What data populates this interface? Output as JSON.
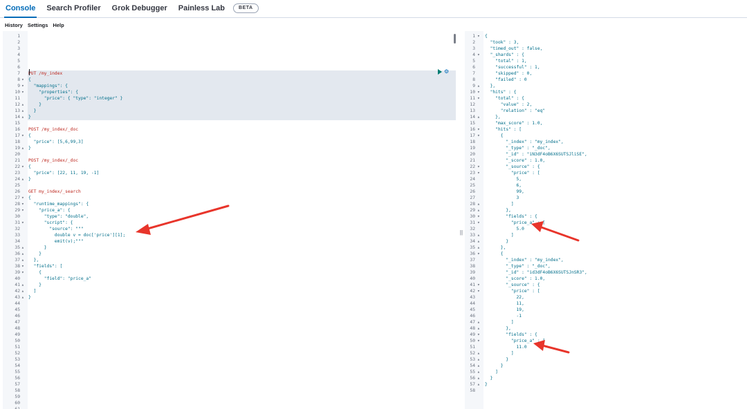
{
  "tabs": [
    {
      "label": "Console",
      "active": true
    },
    {
      "label": "Search Profiler",
      "active": false
    },
    {
      "label": "Grok Debugger",
      "active": false
    },
    {
      "label": "Painless Lab",
      "active": false
    }
  ],
  "beta_badge": "BETA",
  "toolbar": [
    "History",
    "Settings",
    "Help"
  ],
  "divider_glyph": "||",
  "request_lines": [
    {
      "n": "1",
      "f": "",
      "c": ""
    },
    {
      "n": "2",
      "f": "",
      "c": ""
    },
    {
      "n": "3",
      "f": "",
      "c": ""
    },
    {
      "n": "4",
      "f": "",
      "c": ""
    },
    {
      "n": "5",
      "f": "",
      "c": ""
    },
    {
      "n": "6",
      "f": "",
      "c": ""
    },
    {
      "n": "7",
      "f": "",
      "c": "PUT /my_index",
      "method": true,
      "hl": true
    },
    {
      "n": "8",
      "f": "▾",
      "c": "{",
      "hl": true
    },
    {
      "n": "9",
      "f": "▾",
      "c": "  \"mappings\": {",
      "hl": true
    },
    {
      "n": "10",
      "f": "▾",
      "c": "    \"properties\": {",
      "hl": true
    },
    {
      "n": "11",
      "f": "",
      "c": "      \"price\": { \"type\": \"integer\" }",
      "hl": true
    },
    {
      "n": "12",
      "f": "▴",
      "c": "    }",
      "hl": true
    },
    {
      "n": "13",
      "f": "▴",
      "c": "  }",
      "hl": true
    },
    {
      "n": "14",
      "f": "▴",
      "c": "}",
      "hl": true
    },
    {
      "n": "15",
      "f": "",
      "c": ""
    },
    {
      "n": "16",
      "f": "",
      "c": "POST /my_index/_doc",
      "method": true
    },
    {
      "n": "17",
      "f": "▾",
      "c": "{"
    },
    {
      "n": "18",
      "f": "",
      "c": "  \"price\": [5,6,99,3]"
    },
    {
      "n": "19",
      "f": "▴",
      "c": "}"
    },
    {
      "n": "20",
      "f": "",
      "c": ""
    },
    {
      "n": "21",
      "f": "",
      "c": "POST /my_index/_doc",
      "method": true
    },
    {
      "n": "22",
      "f": "▾",
      "c": "{"
    },
    {
      "n": "23",
      "f": "",
      "c": "  \"price\": [22, 11, 19, -1]"
    },
    {
      "n": "24",
      "f": "▴",
      "c": "}"
    },
    {
      "n": "25",
      "f": "",
      "c": ""
    },
    {
      "n": "26",
      "f": "",
      "c": "GET my_index/_search",
      "method": true
    },
    {
      "n": "27",
      "f": "▾",
      "c": "{"
    },
    {
      "n": "28",
      "f": "▾",
      "c": "  \"runtime_mappings\": {"
    },
    {
      "n": "29",
      "f": "▾",
      "c": "    \"price_a\": {"
    },
    {
      "n": "30",
      "f": "",
      "c": "      \"type\": \"double\","
    },
    {
      "n": "31",
      "f": "▾",
      "c": "      \"script\": {"
    },
    {
      "n": "32",
      "f": "",
      "c": "        \"source\": \"\"\""
    },
    {
      "n": "33",
      "f": "",
      "c": "          double v = doc['price'][1];"
    },
    {
      "n": "34",
      "f": "",
      "c": "          emit(v);\"\"\""
    },
    {
      "n": "35",
      "f": "▴",
      "c": "      }"
    },
    {
      "n": "36",
      "f": "▴",
      "c": "    }"
    },
    {
      "n": "37",
      "f": "▴",
      "c": "  },"
    },
    {
      "n": "38",
      "f": "▾",
      "c": "  \"fields\": ["
    },
    {
      "n": "39",
      "f": "▾",
      "c": "    {"
    },
    {
      "n": "40",
      "f": "",
      "c": "      \"field\": \"price_a\""
    },
    {
      "n": "41",
      "f": "▴",
      "c": "    }"
    },
    {
      "n": "42",
      "f": "▴",
      "c": "  ]"
    },
    {
      "n": "43",
      "f": "▴",
      "c": "}"
    },
    {
      "n": "44",
      "f": "",
      "c": ""
    },
    {
      "n": "45",
      "f": "",
      "c": ""
    },
    {
      "n": "46",
      "f": "",
      "c": ""
    },
    {
      "n": "47",
      "f": "",
      "c": ""
    },
    {
      "n": "48",
      "f": "",
      "c": ""
    },
    {
      "n": "49",
      "f": "",
      "c": ""
    },
    {
      "n": "50",
      "f": "",
      "c": ""
    },
    {
      "n": "51",
      "f": "",
      "c": ""
    },
    {
      "n": "52",
      "f": "",
      "c": ""
    },
    {
      "n": "53",
      "f": "",
      "c": ""
    },
    {
      "n": "54",
      "f": "",
      "c": ""
    },
    {
      "n": "55",
      "f": "",
      "c": ""
    },
    {
      "n": "56",
      "f": "",
      "c": ""
    },
    {
      "n": "57",
      "f": "",
      "c": ""
    },
    {
      "n": "58",
      "f": "",
      "c": ""
    },
    {
      "n": "59",
      "f": "",
      "c": ""
    },
    {
      "n": "60",
      "f": "",
      "c": ""
    },
    {
      "n": "61",
      "f": "",
      "c": ""
    }
  ],
  "response_lines": [
    {
      "n": "1",
      "f": "▾",
      "c": "{"
    },
    {
      "n": "2",
      "f": "",
      "c": "  \"took\" : 3,"
    },
    {
      "n": "3",
      "f": "",
      "c": "  \"timed_out\" : false,"
    },
    {
      "n": "4",
      "f": "▾",
      "c": "  \"_shards\" : {"
    },
    {
      "n": "5",
      "f": "",
      "c": "    \"total\" : 1,"
    },
    {
      "n": "6",
      "f": "",
      "c": "    \"successful\" : 1,"
    },
    {
      "n": "7",
      "f": "",
      "c": "    \"skipped\" : 0,"
    },
    {
      "n": "8",
      "f": "",
      "c": "    \"failed\" : 0"
    },
    {
      "n": "9",
      "f": "▴",
      "c": "  },"
    },
    {
      "n": "10",
      "f": "▾",
      "c": "  \"hits\" : {"
    },
    {
      "n": "11",
      "f": "▾",
      "c": "    \"total\" : {"
    },
    {
      "n": "12",
      "f": "",
      "c": "      \"value\" : 2,"
    },
    {
      "n": "13",
      "f": "",
      "c": "      \"relation\" : \"eq\""
    },
    {
      "n": "14",
      "f": "▴",
      "c": "    },"
    },
    {
      "n": "15",
      "f": "",
      "c": "    \"max_score\" : 1.0,"
    },
    {
      "n": "16",
      "f": "▾",
      "c": "    \"hits\" : ["
    },
    {
      "n": "17",
      "f": "▾",
      "c": "      {"
    },
    {
      "n": "18",
      "f": "",
      "c": "        \"_index\" : \"my_index\","
    },
    {
      "n": "19",
      "f": "",
      "c": "        \"_type\" : \"_doc\","
    },
    {
      "n": "20",
      "f": "",
      "c": "        \"_id\" : \"iN3dF4oB6X6SUTSJliSE\","
    },
    {
      "n": "21",
      "f": "",
      "c": "        \"_score\" : 1.0,"
    },
    {
      "n": "22",
      "f": "▾",
      "c": "        \"_source\" : {"
    },
    {
      "n": "23",
      "f": "▾",
      "c": "          \"price\" : ["
    },
    {
      "n": "24",
      "f": "",
      "c": "            5,"
    },
    {
      "n": "25",
      "f": "",
      "c": "            6,"
    },
    {
      "n": "26",
      "f": "",
      "c": "            99,"
    },
    {
      "n": "27",
      "f": "",
      "c": "            3"
    },
    {
      "n": "28",
      "f": "▴",
      "c": "          ]"
    },
    {
      "n": "29",
      "f": "▴",
      "c": "        },"
    },
    {
      "n": "30",
      "f": "▾",
      "c": "        \"fields\" : {"
    },
    {
      "n": "31",
      "f": "▾",
      "c": "          \"price_a\" : ["
    },
    {
      "n": "32",
      "f": "",
      "c": "            5.0"
    },
    {
      "n": "33",
      "f": "▴",
      "c": "          ]"
    },
    {
      "n": "34",
      "f": "▴",
      "c": "        }"
    },
    {
      "n": "35",
      "f": "▴",
      "c": "      },"
    },
    {
      "n": "36",
      "f": "▾",
      "c": "      {"
    },
    {
      "n": "37",
      "f": "",
      "c": "        \"_index\" : \"my_index\","
    },
    {
      "n": "38",
      "f": "",
      "c": "        \"_type\" : \"_doc\","
    },
    {
      "n": "39",
      "f": "",
      "c": "        \"_id\" : \"id3dF4oB6X6SUTSJnSR3\","
    },
    {
      "n": "40",
      "f": "",
      "c": "        \"_score\" : 1.0,"
    },
    {
      "n": "41",
      "f": "▾",
      "c": "        \"_source\" : {"
    },
    {
      "n": "42",
      "f": "▾",
      "c": "          \"price\" : ["
    },
    {
      "n": "43",
      "f": "",
      "c": "            22,"
    },
    {
      "n": "44",
      "f": "",
      "c": "            11,"
    },
    {
      "n": "45",
      "f": "",
      "c": "            19,"
    },
    {
      "n": "46",
      "f": "",
      "c": "            -1"
    },
    {
      "n": "47",
      "f": "▴",
      "c": "          ]"
    },
    {
      "n": "48",
      "f": "▴",
      "c": "        },"
    },
    {
      "n": "49",
      "f": "▾",
      "c": "        \"fields\" : {"
    },
    {
      "n": "50",
      "f": "▾",
      "c": "          \"price_a\" : ["
    },
    {
      "n": "51",
      "f": "",
      "c": "            11.0"
    },
    {
      "n": "52",
      "f": "▴",
      "c": "          ]"
    },
    {
      "n": "53",
      "f": "▴",
      "c": "        }"
    },
    {
      "n": "54",
      "f": "▴",
      "c": "      }"
    },
    {
      "n": "55",
      "f": "▴",
      "c": "    ]"
    },
    {
      "n": "56",
      "f": "▴",
      "c": "  }"
    },
    {
      "n": "57",
      "f": "▴",
      "c": "}"
    },
    {
      "n": "58",
      "f": "",
      "c": ""
    }
  ],
  "icons": {
    "run": "play-icon",
    "settings": "wrench-icon"
  },
  "colors": {
    "accent": "#006bb8",
    "method": "#bd271e",
    "string": "#006e8a",
    "arrow": "#e8352b"
  }
}
